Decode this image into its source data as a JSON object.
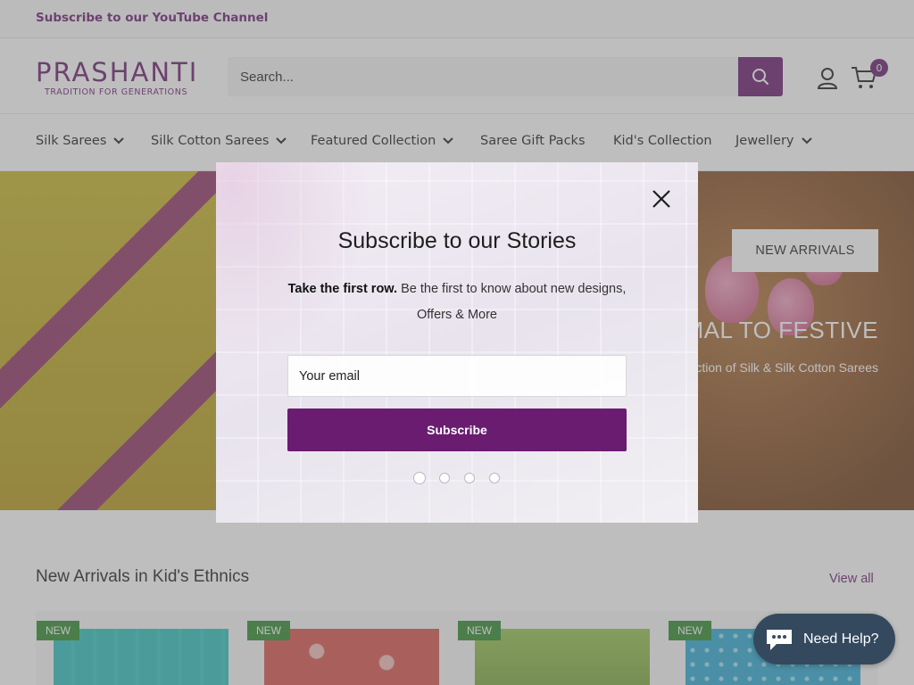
{
  "announcement": {
    "text": "Subscribe to our YouTube Channel"
  },
  "header": {
    "logo_main": "PRASHANTI",
    "logo_sub": "TRADITION FOR GENERATIONS",
    "search_placeholder": "Search...",
    "cart_count": "0"
  },
  "nav": {
    "items": [
      {
        "label": "Silk Sarees",
        "has_dropdown": true
      },
      {
        "label": "Silk Cotton Sarees",
        "has_dropdown": true
      },
      {
        "label": "Featured Collection",
        "has_dropdown": true
      },
      {
        "label": "Saree Gift Packs",
        "has_dropdown": false
      },
      {
        "label": "Kid's Collection",
        "has_dropdown": false
      },
      {
        "label": "Jewellery",
        "has_dropdown": true
      }
    ]
  },
  "hero": {
    "title": "FORMAL TO FESTIVE",
    "subtitle": "Lovely collection of Silk & Silk Cotton Sarees",
    "button": "NEW ARRIVALS"
  },
  "section": {
    "title": "New Arrivals in Kid's Ethnics",
    "view_all": "View all",
    "products": [
      {
        "badge": "NEW",
        "color": "#2fbfbf"
      },
      {
        "badge": "NEW",
        "color": "#d9554e"
      },
      {
        "badge": "NEW",
        "color": "#8cb84a"
      },
      {
        "badge": "NEW",
        "color": "#2fa9d6"
      }
    ]
  },
  "modal": {
    "title": "Subscribe to our Stories",
    "text_bold": "Take the first row.",
    "text_rest": " Be the first to know about new designs, Offers & More",
    "email_placeholder": "Your email",
    "subscribe_label": "Subscribe",
    "slides": 4,
    "active_slide": 0
  },
  "chat": {
    "label": "Need Help?"
  },
  "colors": {
    "brand": "#6a1c70",
    "badge": "#2e8a2e",
    "chat": "#34495e"
  }
}
